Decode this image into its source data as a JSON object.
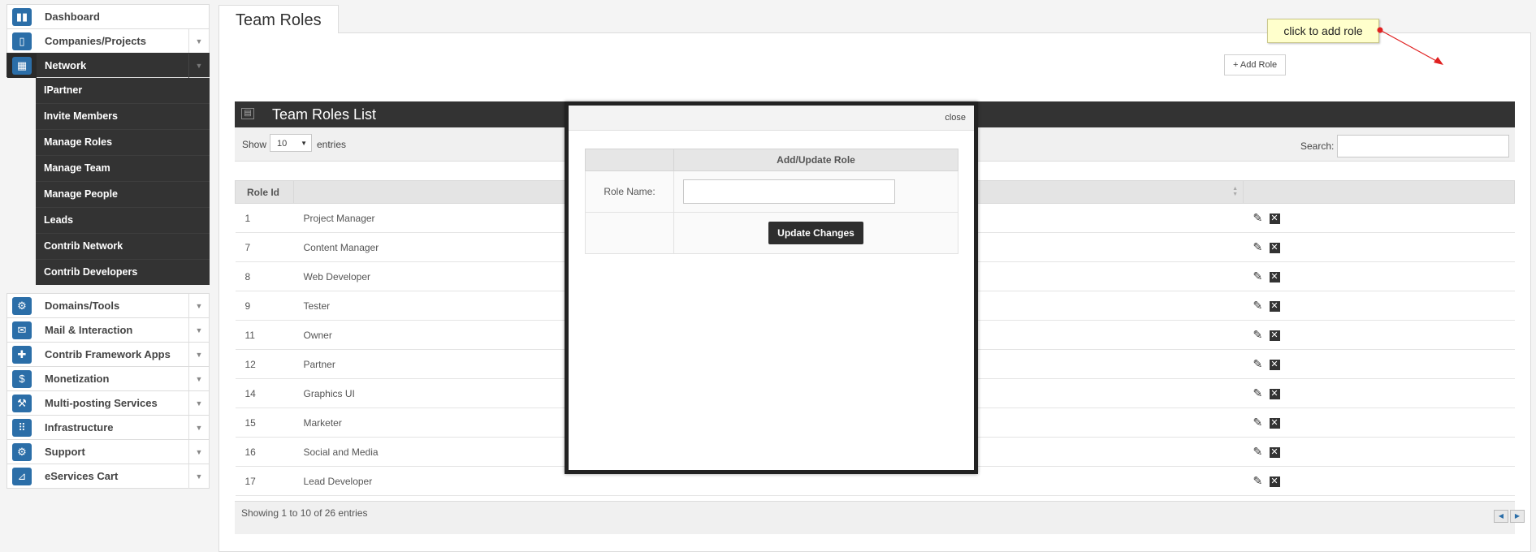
{
  "sidebar": {
    "items": [
      {
        "label": "Dashboard",
        "icon": "bar-chart-icon",
        "glyph": "▮▮",
        "caret": false
      },
      {
        "label": "Companies/Projects",
        "icon": "mobile-icon",
        "glyph": "▯",
        "caret": true
      }
    ],
    "active": {
      "label": "Network",
      "icon": "network-icon",
      "glyph": "▦"
    },
    "subitems": [
      "IPartner",
      "Invite Members",
      "Manage Roles",
      "Manage Team",
      "Manage People",
      "Leads",
      "Contrib Network",
      "Contrib Developers"
    ],
    "items2": [
      {
        "label": "Domains/Tools",
        "icon": "gear-icon",
        "glyph": "⚙"
      },
      {
        "label": "Mail & Interaction",
        "icon": "mail-icon",
        "glyph": "✉"
      },
      {
        "label": "Contrib Framework Apps",
        "icon": "puzzle-icon",
        "glyph": "✚"
      },
      {
        "label": "Monetization",
        "icon": "dollar-icon",
        "glyph": "$"
      },
      {
        "label": "Multi-posting Services",
        "icon": "hammer-icon",
        "glyph": "⚒"
      },
      {
        "label": "Infrastructure",
        "icon": "grid-icon",
        "glyph": "⠿"
      },
      {
        "label": "Support",
        "icon": "gear-icon",
        "glyph": "⚙"
      },
      {
        "label": "eServices Cart",
        "icon": "cart-icon",
        "glyph": "⊿"
      }
    ]
  },
  "page": {
    "tab_title": "Team Roles"
  },
  "toolbar": {
    "add_role_label": "+ Add Role"
  },
  "tooltip": {
    "text": "click to add role"
  },
  "panel": {
    "title": "Team Roles List"
  },
  "list_controls": {
    "show_label": "Show",
    "page_size": "10",
    "entries_label": "entries",
    "search_label": "Search:",
    "search_value": ""
  },
  "table": {
    "headers": [
      "Role Id",
      "",
      ""
    ],
    "rows": [
      {
        "id": "1",
        "name": "Project Manager"
      },
      {
        "id": "7",
        "name": "Content Manager"
      },
      {
        "id": "8",
        "name": "Web Developer"
      },
      {
        "id": "9",
        "name": "Tester"
      },
      {
        "id": "11",
        "name": "Owner"
      },
      {
        "id": "12",
        "name": "Partner"
      },
      {
        "id": "14",
        "name": "Graphics UI"
      },
      {
        "id": "15",
        "name": "Marketer"
      },
      {
        "id": "16",
        "name": "Social and Media"
      },
      {
        "id": "17",
        "name": "Lead Developer"
      }
    ],
    "info": "Showing 1 to 10 of 26 entries"
  },
  "modal": {
    "close_label": "close",
    "form_title": "Add/Update Role",
    "role_name_label": "Role Name:",
    "role_name_value": "",
    "submit_label": "Update Changes"
  },
  "colors": {
    "accent_blue": "#2b6ea8",
    "dark": "#333333",
    "tooltip_bg": "#ffffcc",
    "arrow_red": "#e02020"
  }
}
